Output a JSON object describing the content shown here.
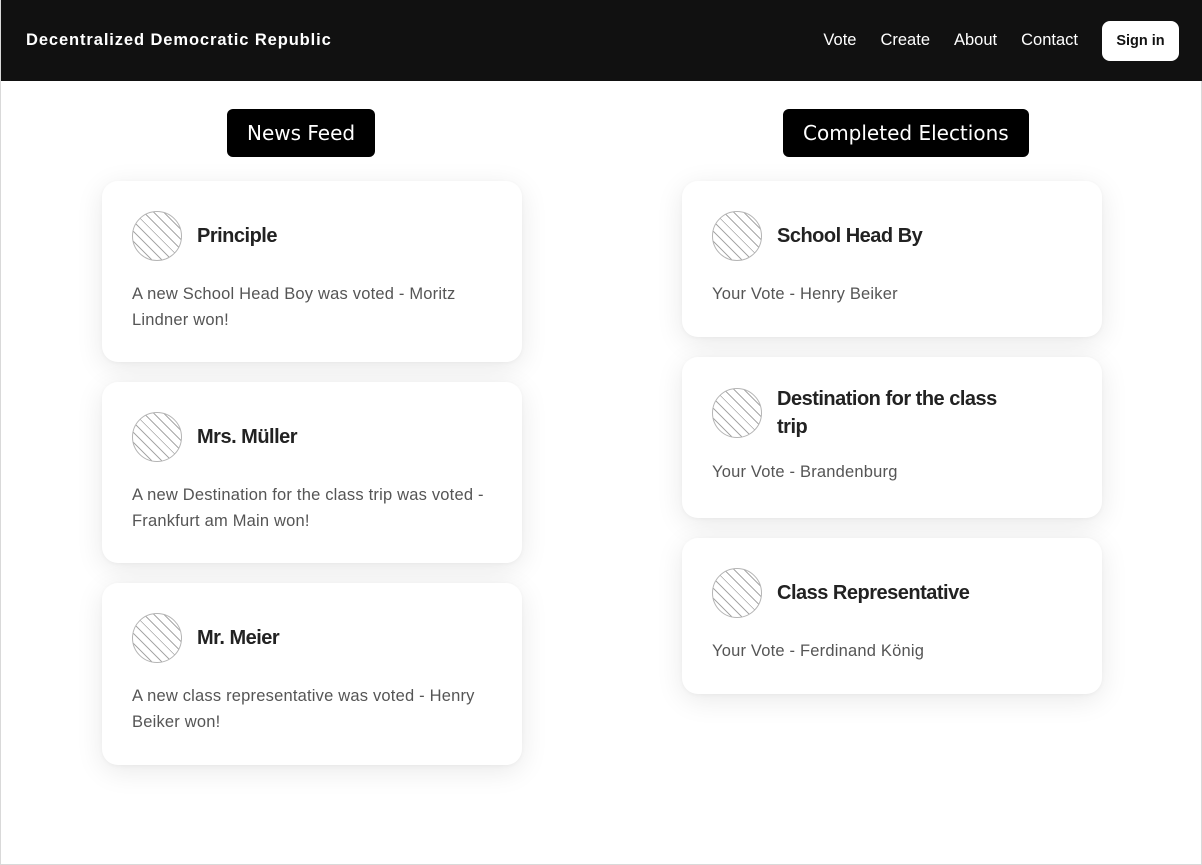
{
  "nav": {
    "brand": "Decentralized Democratic Republic",
    "links": [
      "Vote",
      "Create",
      "About",
      "Contact"
    ],
    "signin_label": "Sign in"
  },
  "news_feed": {
    "heading": "News Feed",
    "items": [
      {
        "author": "Principle",
        "text": "A new School Head Boy was voted - Moritz Lindner won!"
      },
      {
        "author": "Mrs. Müller",
        "text": "A new Destination for the class trip was voted - Frankfurt am Main won!"
      },
      {
        "author": "Mr. Meier",
        "text": "A new class representative was voted - Henry Beiker won!"
      }
    ]
  },
  "completed_elections": {
    "heading": "Completed Elections",
    "items": [
      {
        "title": "School Head By",
        "text": "Your Vote - Henry Beiker"
      },
      {
        "title": "Destination for the class trip",
        "text": "Your Vote - Brandenburg"
      },
      {
        "title": "Class Representative",
        "text": "Your Vote - Ferdinand König"
      }
    ]
  }
}
